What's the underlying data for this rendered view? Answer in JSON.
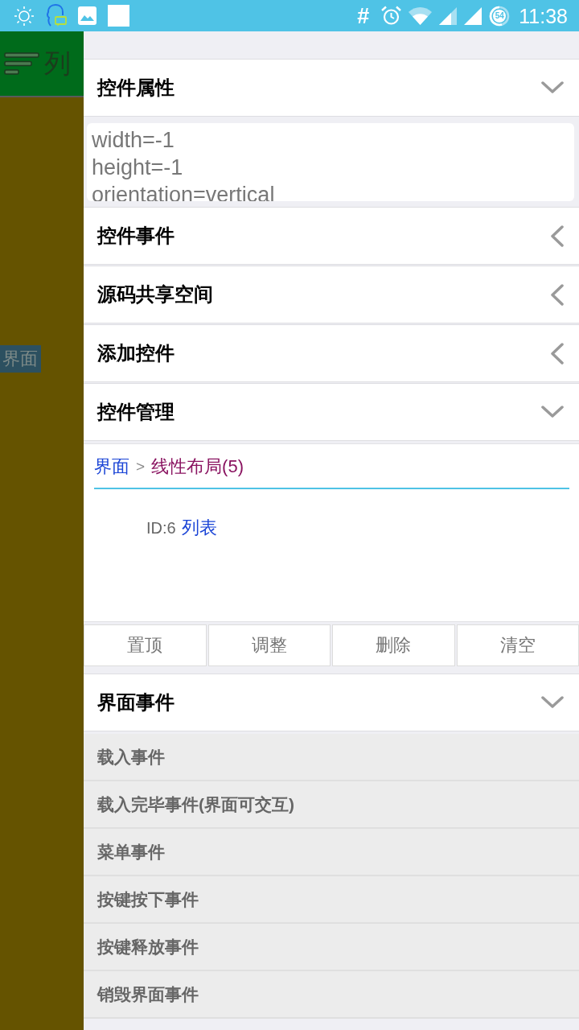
{
  "status_bar": {
    "hash_symbol": "#",
    "battery_percent": "54",
    "time": "11:38"
  },
  "background_app": {
    "toolbar_title": "列",
    "view_label": "界面"
  },
  "drawer": {
    "sections": [
      {
        "title": "控件属性",
        "expanded": true,
        "kind": "properties",
        "lines": [
          "width=-1",
          "height=-1",
          "orientation=vertical"
        ]
      },
      {
        "title": "控件事件",
        "expanded": false
      },
      {
        "title": "源码共享空间",
        "expanded": false
      },
      {
        "title": "添加控件",
        "expanded": false
      },
      {
        "title": "控件管理",
        "expanded": true,
        "kind": "manager",
        "breadcrumb": {
          "separator": ">",
          "items": [
            {
              "label": "界面",
              "selected": false
            },
            {
              "label": "线性布局(5)",
              "selected": true
            }
          ]
        },
        "children": [
          {
            "id": "ID:6",
            "name": "列表"
          }
        ],
        "buttons": [
          "置顶",
          "调整",
          "删除",
          "清空"
        ]
      },
      {
        "title": "界面事件",
        "expanded": true,
        "kind": "events",
        "events": [
          "载入事件",
          "载入完毕事件(界面可交互)",
          "菜单事件",
          "按键按下事件",
          "按键释放事件",
          "销毁界面事件"
        ]
      }
    ]
  }
}
